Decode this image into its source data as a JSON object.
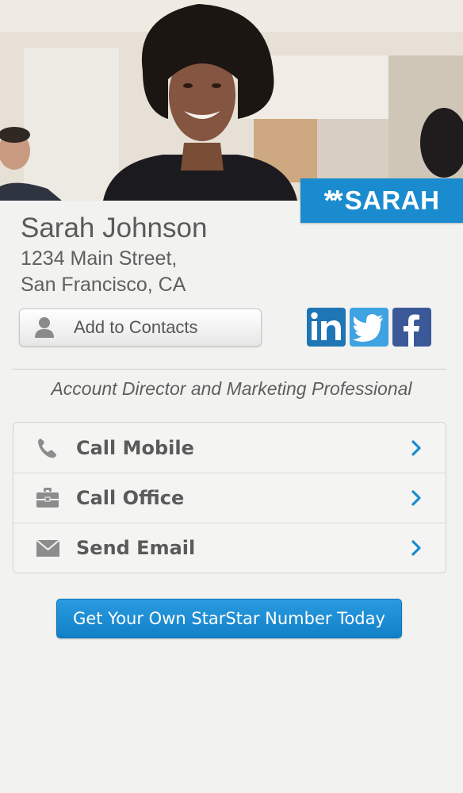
{
  "hero": {
    "tag_stars": "**",
    "tag_name": "SARAH"
  },
  "profile": {
    "name": "Sarah Johnson",
    "address_line1": "1234 Main Street,",
    "address_line2": "San Francisco, CA",
    "title": "Account Director and Marketing Professional"
  },
  "buttons": {
    "add_contacts": "Add to Contacts",
    "cta": "Get Your Own StarStar Number Today"
  },
  "social": [
    {
      "name": "linkedin-icon",
      "glyph": "in",
      "color": "#1f76b4"
    },
    {
      "name": "twitter-icon",
      "color": "#3fa3e1"
    },
    {
      "name": "facebook-icon",
      "glyph": "f",
      "color": "#3b5998"
    }
  ],
  "actions": [
    {
      "label": "Call Mobile",
      "icon": "phone-icon"
    },
    {
      "label": "Call Office",
      "icon": "briefcase-icon"
    },
    {
      "label": "Send Email",
      "icon": "envelope-icon"
    }
  ],
  "colors": {
    "accent": "#1b8bd0",
    "chevron": "#1b8bd0",
    "background": "#f2f2f0"
  }
}
